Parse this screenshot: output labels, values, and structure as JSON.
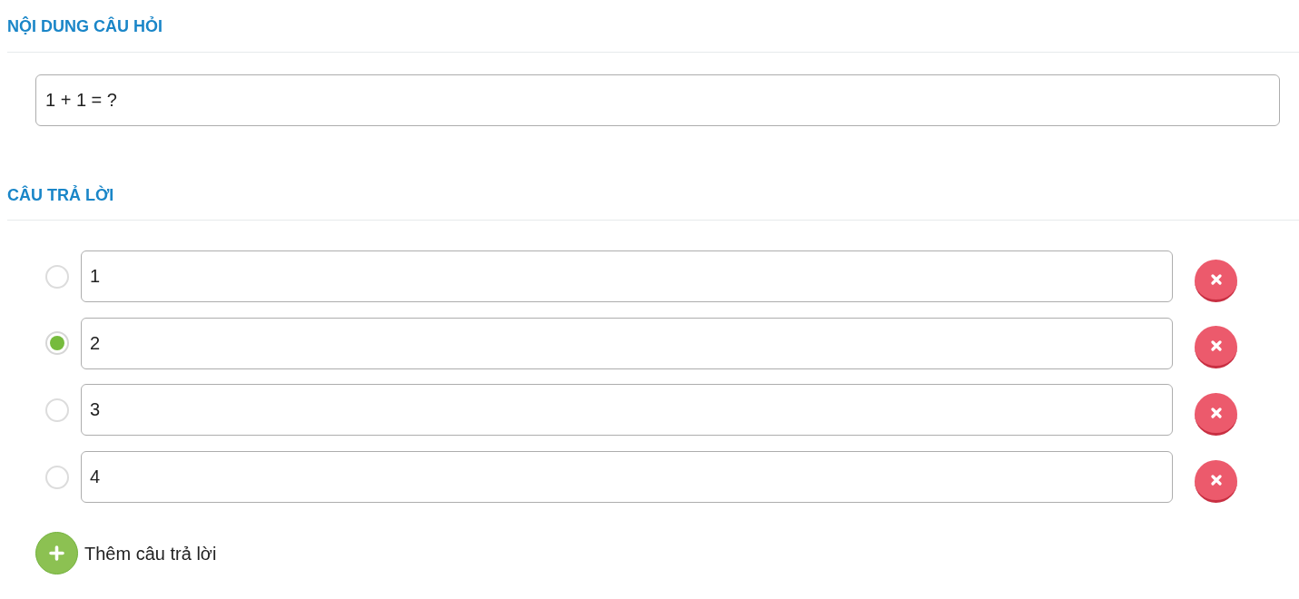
{
  "question_section": {
    "title": "NỘI DUNG CÂU HỎI",
    "question": {
      "value": "1 + 1 = ?"
    }
  },
  "answers_section": {
    "title": "CÂU TRẢ LỜI",
    "answers": [
      {
        "value": "1",
        "selected": false
      },
      {
        "value": "2",
        "selected": true
      },
      {
        "value": "3",
        "selected": false
      },
      {
        "value": "4",
        "selected": false
      }
    ],
    "add_button": {
      "label": "Thêm câu trả lời"
    }
  }
}
